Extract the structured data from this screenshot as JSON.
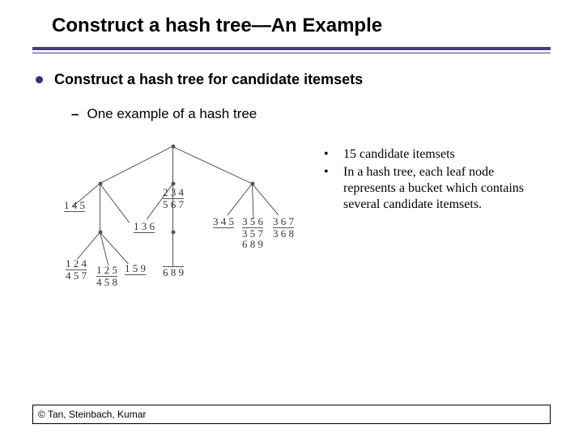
{
  "slide": {
    "title": "Construct a hash tree—An Example",
    "bullet": "Construct a hash tree for candidate itemsets",
    "sub": "One example of a hash tree",
    "dash": "–"
  },
  "notes": {
    "items": [
      "15 candidate itemsets",
      "In a hash tree, each leaf node represents a bucket which contains several candidate itemsets."
    ],
    "mark": "•"
  },
  "tree": {
    "leaves": {
      "l145": {
        "top": "1 4 5",
        "under": ""
      },
      "l234": {
        "top": "2 3 4",
        "under": "5 6 7"
      },
      "l124": {
        "top": "1 2 4",
        "under": "4 5 7"
      },
      "l125": {
        "top": "1 2 5",
        "under": "4 5 8"
      },
      "l136": {
        "top": "1 3 6",
        "under": ""
      },
      "l159": {
        "top": "1 5 9",
        "under": ""
      },
      "l345": {
        "top": "3 4 5",
        "under": ""
      },
      "l356": {
        "top": "3 5 6",
        "under": "3 5 7\n6 8 9"
      },
      "l367": {
        "top": "3 6 7",
        "under": "3 6 8"
      }
    }
  },
  "footer": "© Tan, Steinbach, Kumar"
}
